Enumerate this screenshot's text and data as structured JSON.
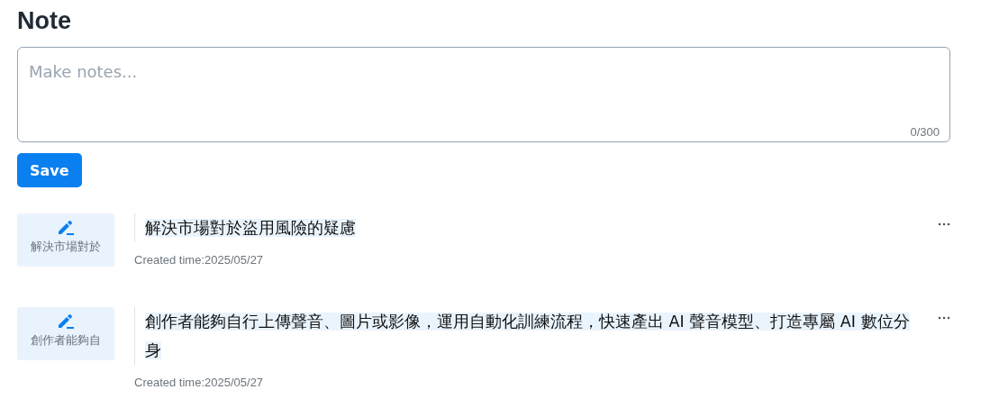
{
  "title": "Note",
  "note_field": {
    "placeholder": "Make notes...",
    "counter": "0/300"
  },
  "save_button": "Save",
  "notes": [
    {
      "thumbnail_label": "解決市場對於",
      "text": "解決市場對於盜用風險的疑慮",
      "created": "Created time:2025/05/27"
    },
    {
      "thumbnail_label": "創作者能夠自",
      "text": "創作者能夠自行上傳聲音、圖片或影像，運用自動化訓練流程，快速產出 AI 聲音模型、打造專屬 AI 數位分身",
      "created": "Created time:2025/05/27"
    }
  ]
}
